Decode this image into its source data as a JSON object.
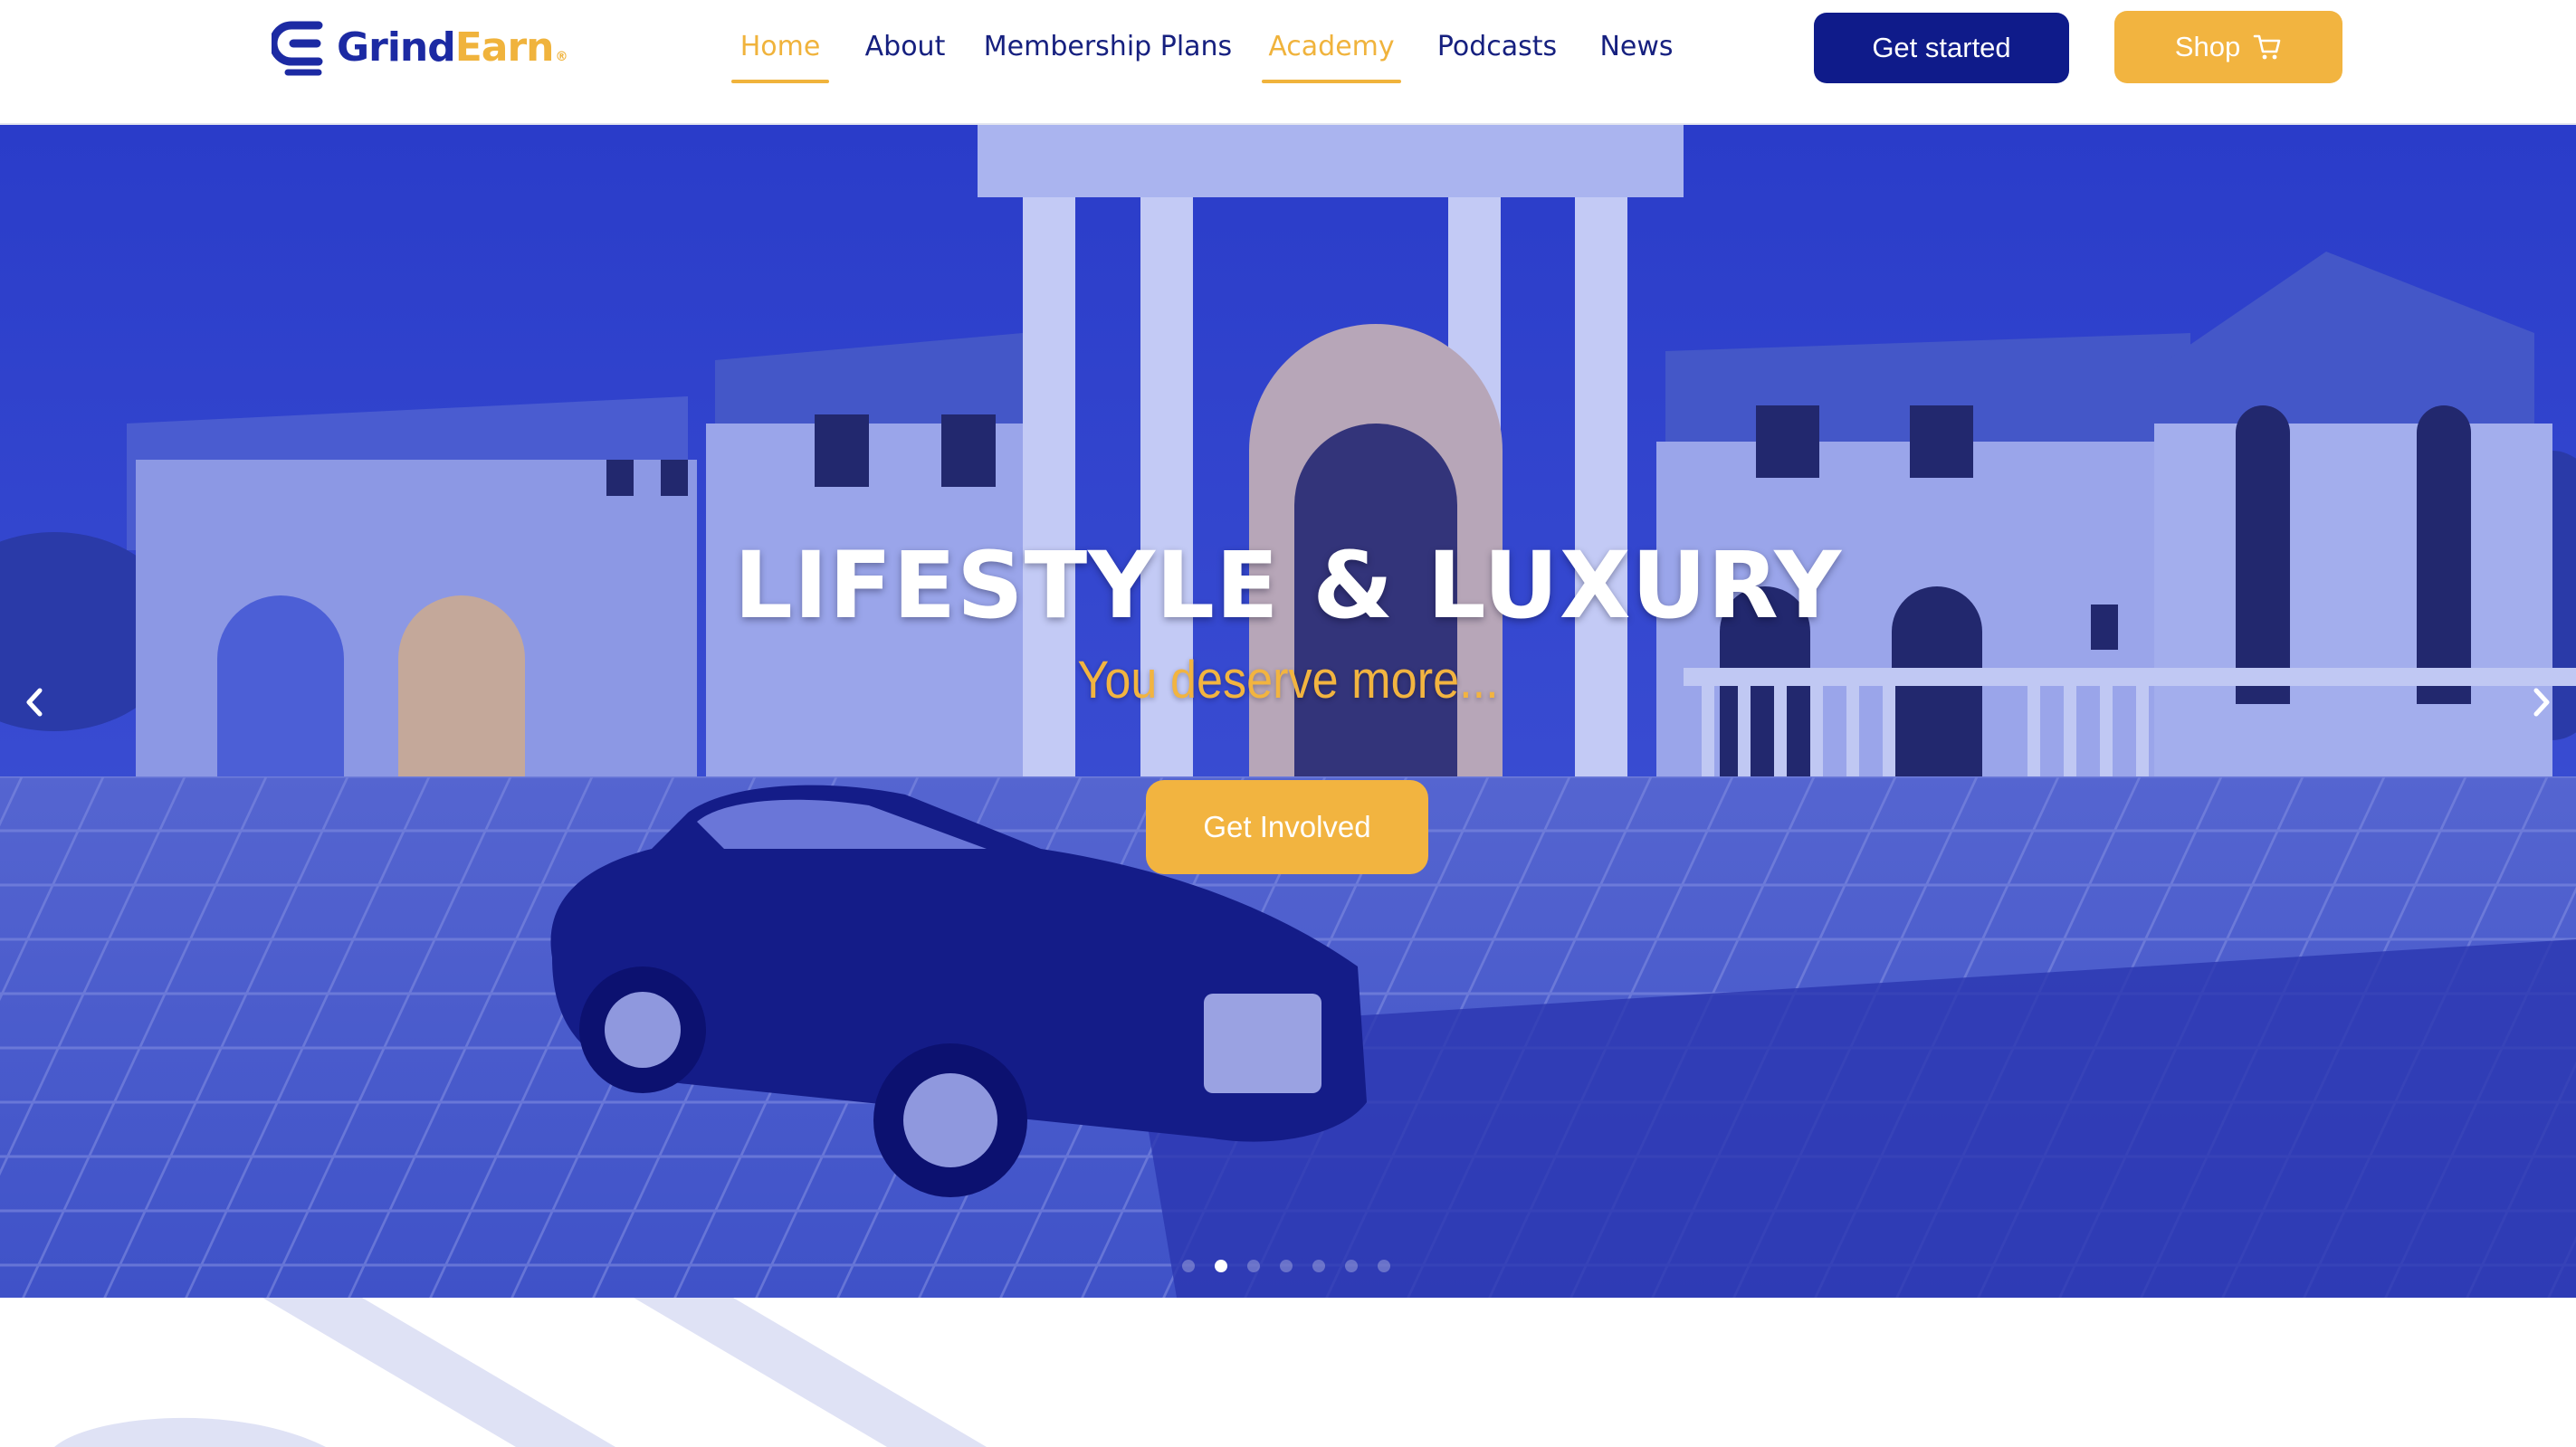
{
  "brand": {
    "name_part1": "Grind",
    "name_part2": "Earn",
    "mark": "®",
    "primary_color": "#0f1b8a",
    "accent_color": "#f2b440"
  },
  "nav": {
    "items": [
      {
        "label": "Home",
        "active": true
      },
      {
        "label": "About",
        "active": false
      },
      {
        "label": "Membership Plans",
        "active": false
      },
      {
        "label": "Academy",
        "active": true
      },
      {
        "label": "Podcasts",
        "active": false
      },
      {
        "label": "News",
        "active": false
      }
    ]
  },
  "header_actions": {
    "get_started": "Get started",
    "shop": "Shop",
    "shop_icon": "cart-icon"
  },
  "hero": {
    "title": "LIFESTYLE & LUXURY",
    "subtitle": "You deserve more...",
    "cta": "Get Involved",
    "prev_icon": "chevron-left-icon",
    "next_icon": "chevron-right-icon",
    "slide_count": 7,
    "active_slide": 2,
    "overlay_color": "#2233c0"
  }
}
